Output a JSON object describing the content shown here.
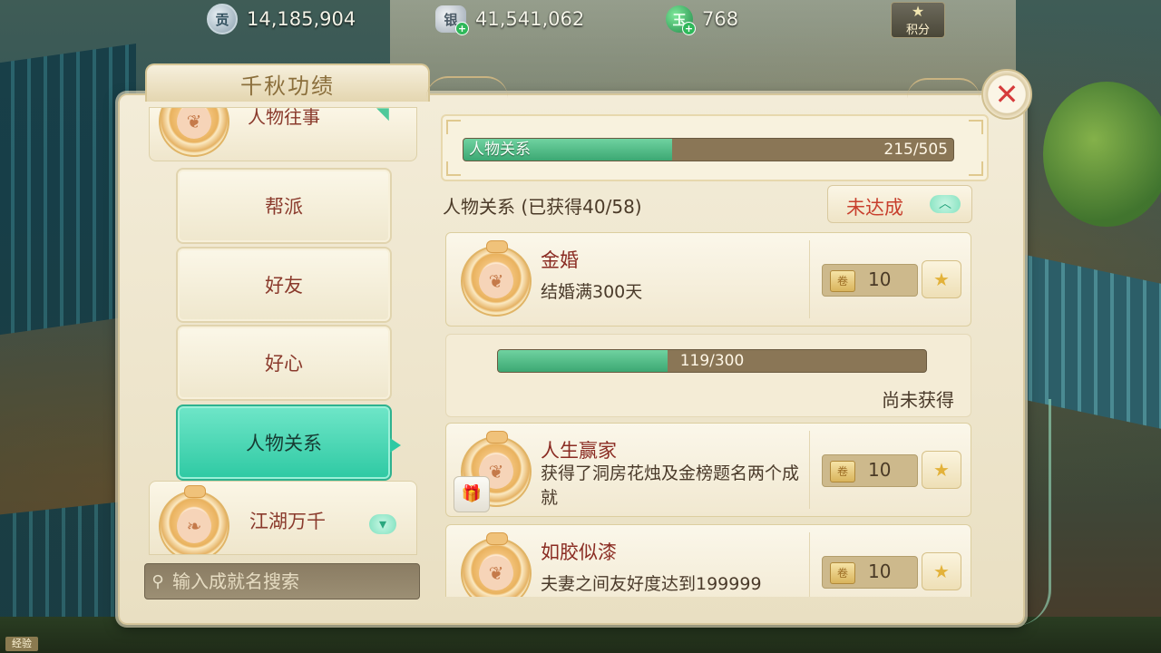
{
  "currency": {
    "gong": {
      "icon": "gong-coin-icon",
      "glyph": "贡",
      "value": "14,185,904"
    },
    "silver": {
      "icon": "silver-ingot-icon",
      "glyph": "银",
      "value": "41,541,062"
    },
    "jade": {
      "icon": "jade-icon",
      "glyph": "玉",
      "value": "768"
    },
    "points_label": "积分"
  },
  "panel": {
    "title": "千秋功绩",
    "close_symbol": "✕"
  },
  "nav": {
    "top_partial_label": "人物往事",
    "items": [
      {
        "label": "帮派",
        "active": false
      },
      {
        "label": "好友",
        "active": false
      },
      {
        "label": "好心",
        "active": false
      },
      {
        "label": "人物关系",
        "active": true
      }
    ],
    "bottom_label": "江湖万千",
    "search_placeholder": "输入成就名搜索"
  },
  "summary": {
    "label": "人物关系",
    "value": "215/505",
    "progress": 0.4257
  },
  "section": {
    "title": "人物关系 (已获得40/58)",
    "filter_label": "未达成",
    "filter_icon": "chevron-up-icon"
  },
  "achievements": [
    {
      "name": "金婚",
      "desc": "结婚满300天",
      "reward": "10",
      "reward_glyph": "卷",
      "medal_glyph": "❦",
      "has_gift": false
    },
    {
      "name": "人生赢家",
      "desc": "获得了洞房花烛及金榜题名两个成就",
      "reward": "10",
      "reward_glyph": "卷",
      "medal_glyph": "❦",
      "has_gift": true,
      "gift_glyph": "🎁"
    },
    {
      "name": "如胶似漆",
      "desc": "夫妻之间友好度达到199999",
      "reward": "10",
      "reward_glyph": "卷",
      "medal_glyph": "❦",
      "has_gift": false
    }
  ],
  "progress_detail": {
    "value": "119/300",
    "progress": 0.3967,
    "status": "尚未获得"
  },
  "bottom_tag": "经验",
  "colors": {
    "accent_teal": "#2ec9a3",
    "title_red": "#8a2b22",
    "filter_red": "#c8402e",
    "bar_green": "#3ca873"
  }
}
